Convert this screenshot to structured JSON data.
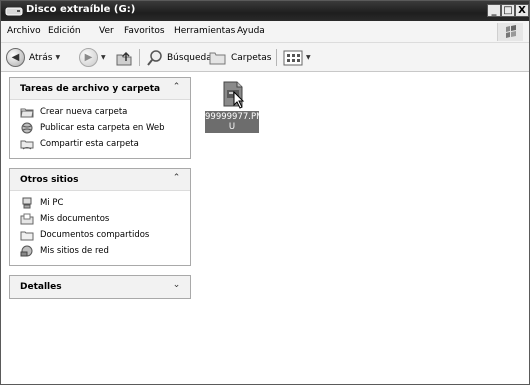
{
  "window": {
    "title": "Disco extraíble (G:)",
    "buttons": {
      "minimize": "_",
      "maximize": "□",
      "close": "X"
    }
  },
  "menu": [
    "Archivo",
    "Edición",
    "Ver",
    "Favoritos",
    "Herramientas",
    "Ayuda"
  ],
  "toolbar": {
    "back_label": "Atrás",
    "search_label": "Búsqueda",
    "folders_label": "Carpetas"
  },
  "panels": {
    "tasks": {
      "title": "Tareas de archivo y carpeta",
      "items": [
        "Crear nueva carpeta",
        "Publicar esta carpeta en Web",
        "Compartir esta carpeta"
      ]
    },
    "other_places": {
      "title": "Otros sitios",
      "items": [
        "Mi PC",
        "Mis documentos",
        "Documentos compartidos",
        "Mis sitios de red"
      ]
    },
    "details": {
      "title": "Detalles"
    }
  },
  "files": [
    {
      "name_line1": "99999977.PM",
      "name_line2": "U"
    }
  ],
  "icons": {
    "collapse": "«",
    "expand": "»"
  }
}
